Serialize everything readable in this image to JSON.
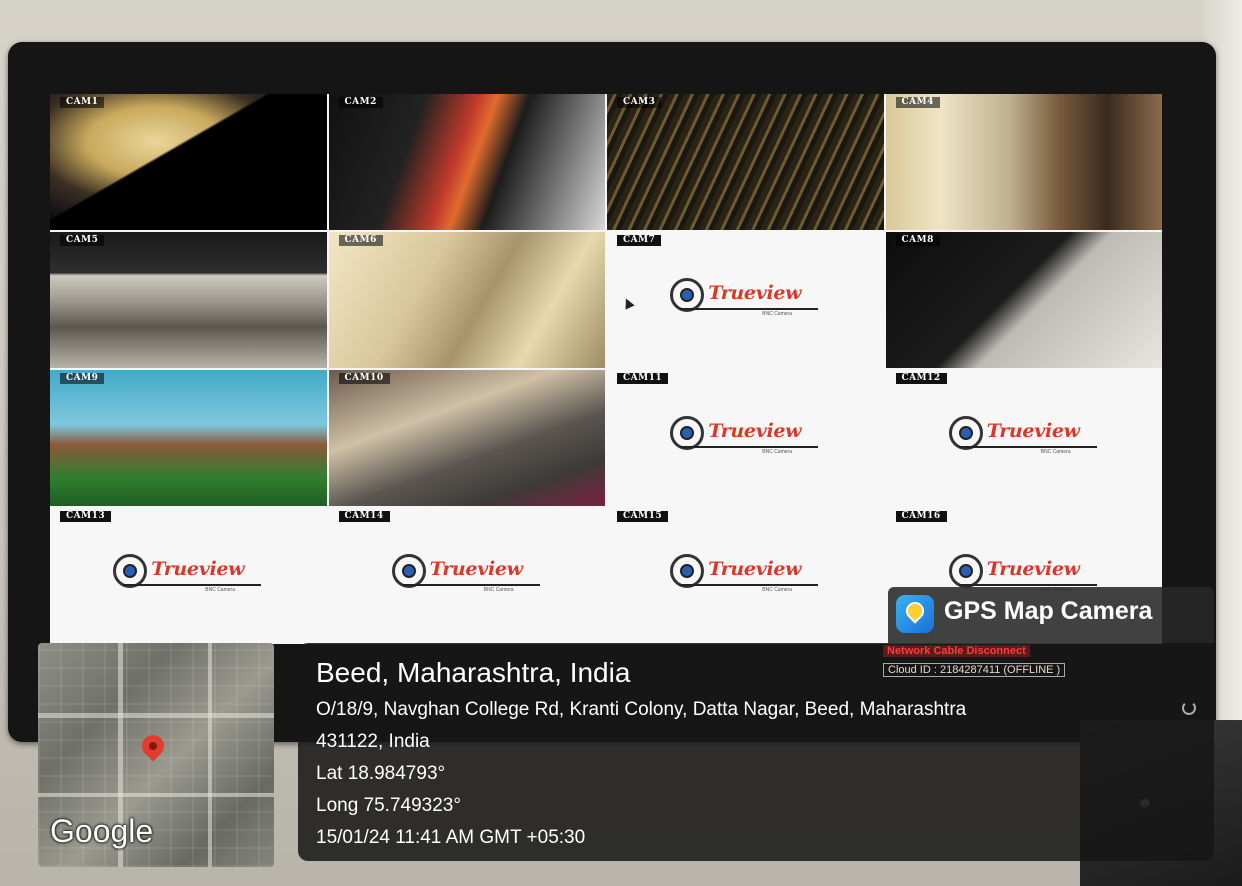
{
  "cameras": [
    {
      "label": "CAM1"
    },
    {
      "label": "CAM2"
    },
    {
      "label": "CAM3"
    },
    {
      "label": "CAM4"
    },
    {
      "label": "CAM5"
    },
    {
      "label": "CAM6"
    },
    {
      "label": "CAM7"
    },
    {
      "label": "CAM8"
    },
    {
      "label": "CAM9"
    },
    {
      "label": "CAM10"
    },
    {
      "label": "CAM11"
    },
    {
      "label": "CAM12"
    },
    {
      "label": "CAM13"
    },
    {
      "label": "CAM14"
    },
    {
      "label": "CAM15"
    },
    {
      "label": "CAM16"
    }
  ],
  "logo": {
    "brand": "Trueview",
    "subtitle": "BNC Camera"
  },
  "dvr_status": {
    "network": "Network Cable Disconnect",
    "cloud": "Cloud ID :  2184287411  (OFFLINE )"
  },
  "gps_badge": {
    "title": "GPS Map Camera",
    "icon": "location-pin-icon"
  },
  "location": {
    "place": "Beed, Maharashtra, India",
    "address_line1": "O/18/9, Navghan College Rd, Kranti Colony, Datta Nagar, Beed, Maharashtra",
    "address_line2": "431122, India",
    "lat": "Lat 18.984793°",
    "long": "Long 75.749323°",
    "timestamp": "15/01/24 11:41 AM GMT +05:30"
  },
  "map": {
    "provider": "Google",
    "pin_color": "#e53b2e"
  }
}
